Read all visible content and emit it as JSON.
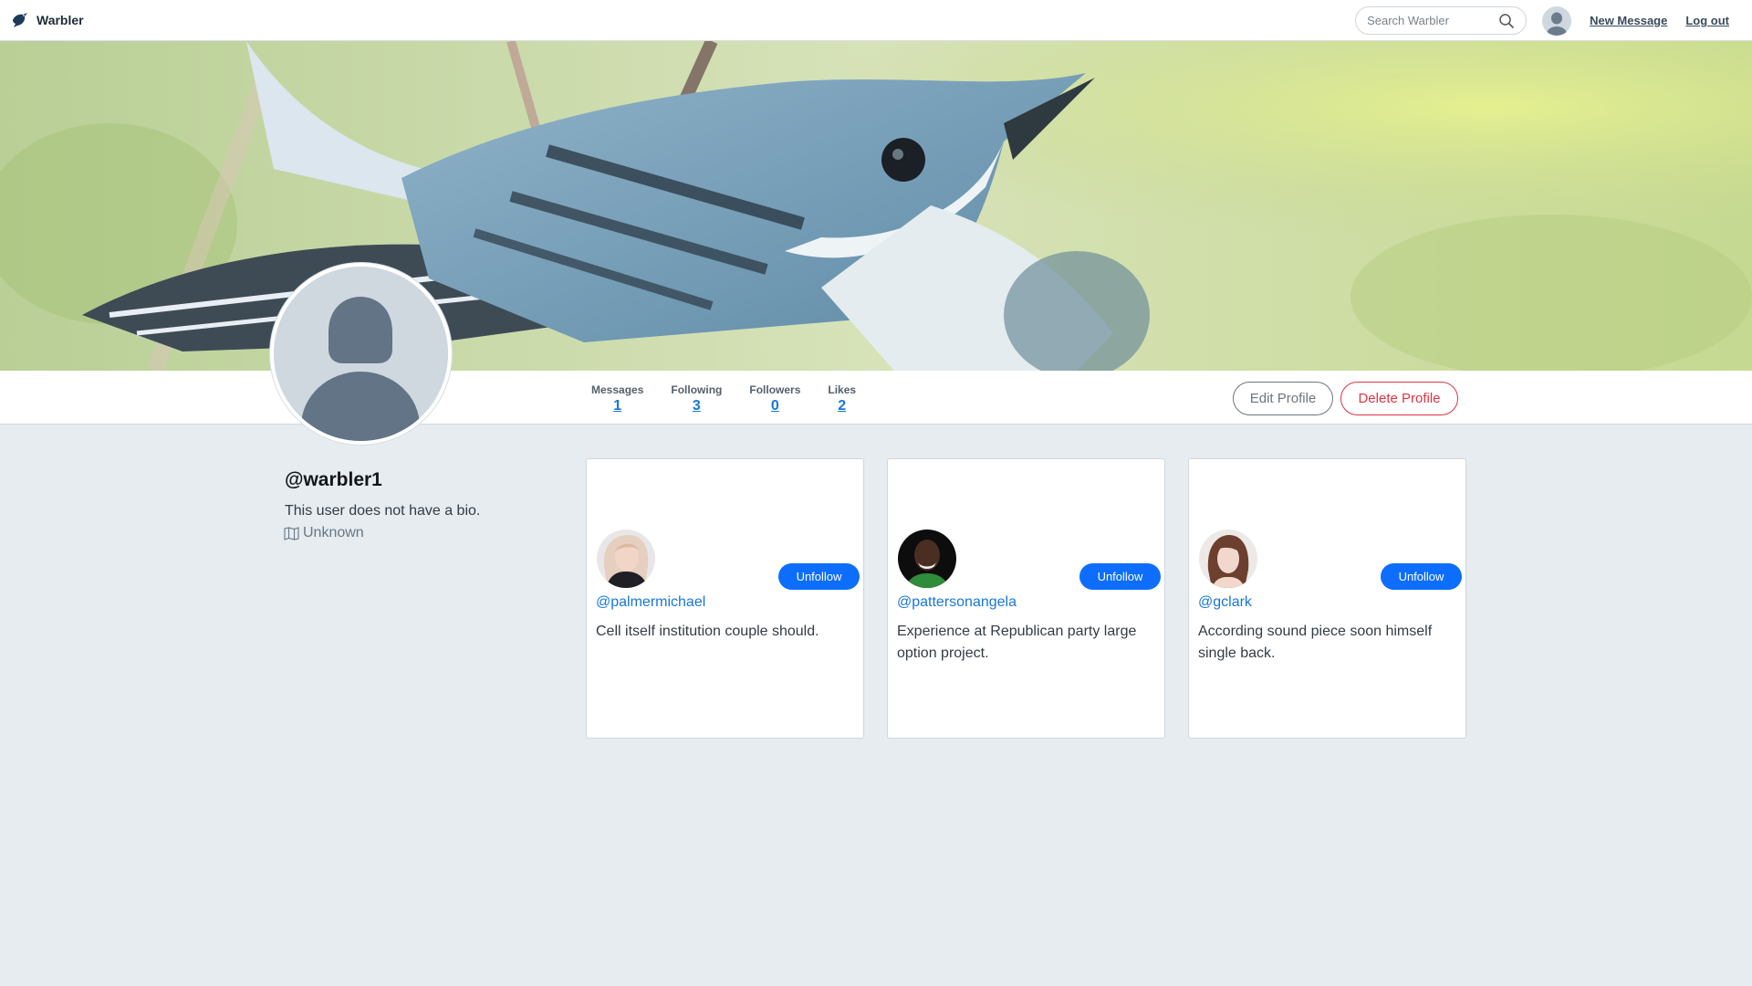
{
  "nav": {
    "brand": "Warbler",
    "search_placeholder": "Search Warbler",
    "new_message": "New Message",
    "logout": "Log out"
  },
  "profile": {
    "username": "@warbler1",
    "bio": "This user does not have a bio.",
    "location": "Unknown",
    "stats": [
      {
        "label": "Messages",
        "value": "1"
      },
      {
        "label": "Following",
        "value": "3"
      },
      {
        "label": "Followers",
        "value": "0"
      },
      {
        "label": "Likes",
        "value": "2"
      }
    ],
    "edit_label": "Edit Profile",
    "delete_label": "Delete Profile"
  },
  "following": [
    {
      "handle": "@palmermichael",
      "bio": "Cell itself institution couple should.",
      "button": "Unfollow"
    },
    {
      "handle": "@pattersonangela",
      "bio": "Experience at Republican party large option project.",
      "button": "Unfollow"
    },
    {
      "handle": "@gclark",
      "bio": "According sound piece soon himself single back.",
      "button": "Unfollow"
    }
  ],
  "colors": {
    "link": "#1877d8",
    "primary": "#0d6efd",
    "danger": "#dc3545",
    "background": "#e6ecf0"
  }
}
